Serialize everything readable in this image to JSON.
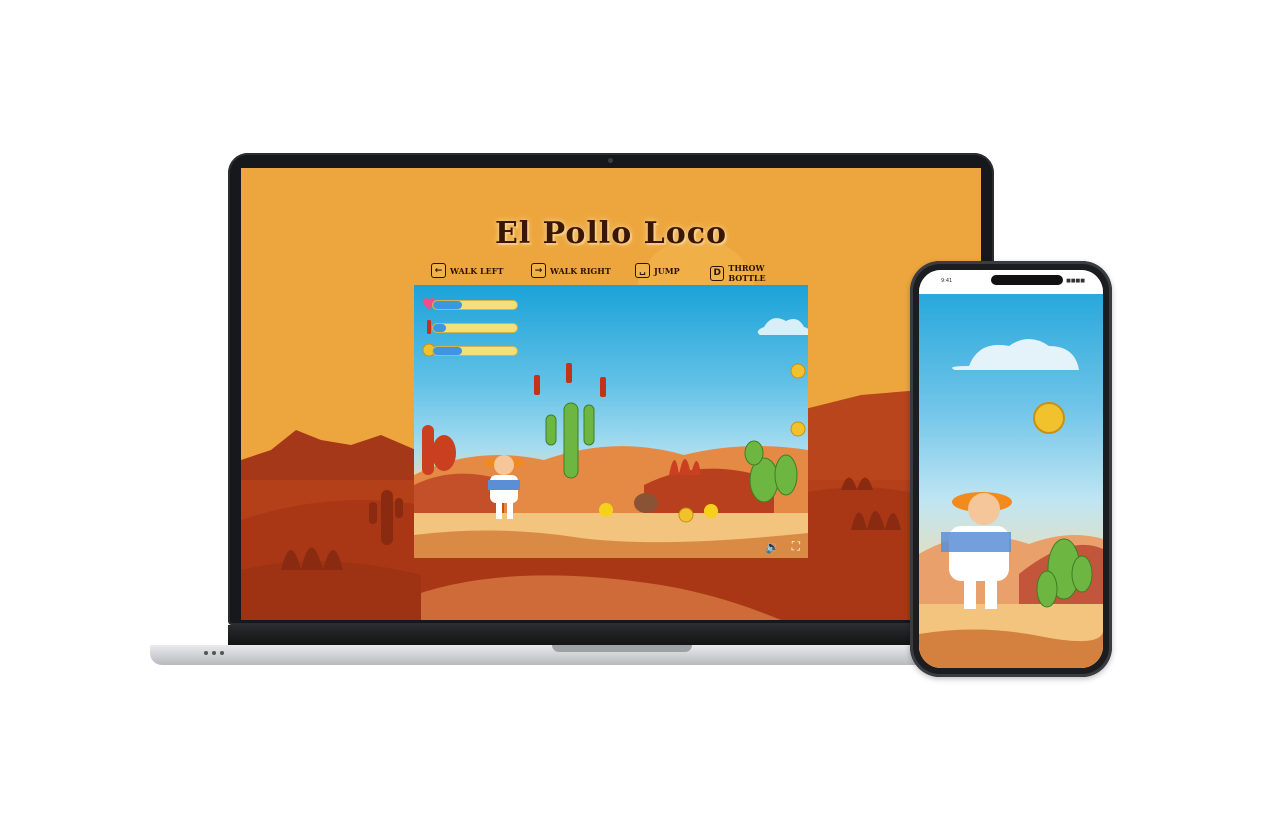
{
  "game": {
    "title": "El Pollo Loco",
    "controls": [
      {
        "key": "←",
        "label": "Walk left"
      },
      {
        "key": "→",
        "label": "Walk right"
      },
      {
        "key": "␣",
        "label": "Jump"
      },
      {
        "key": "D",
        "label": "Throw bottle"
      }
    ],
    "status_bars": [
      {
        "name": "health",
        "icon": "heart-icon",
        "level": 0.35
      },
      {
        "name": "bottles",
        "icon": "bottle-icon",
        "level": 0.15
      },
      {
        "name": "coins",
        "icon": "coin-icon",
        "level": 0.35
      }
    ],
    "canvas_controls": [
      {
        "icon": "sound-icon",
        "glyph": "🔉"
      },
      {
        "icon": "fullscreen-icon",
        "glyph": "⛶"
      }
    ]
  },
  "phone": {
    "status_left": "9:41",
    "status_right": "■■■■"
  },
  "colors": {
    "page_background": "#eda63e",
    "title": "#3a1606",
    "bar_fill": "#3d96e0",
    "bar_track": "#f4e07a",
    "sky": "#1ba2d8"
  }
}
